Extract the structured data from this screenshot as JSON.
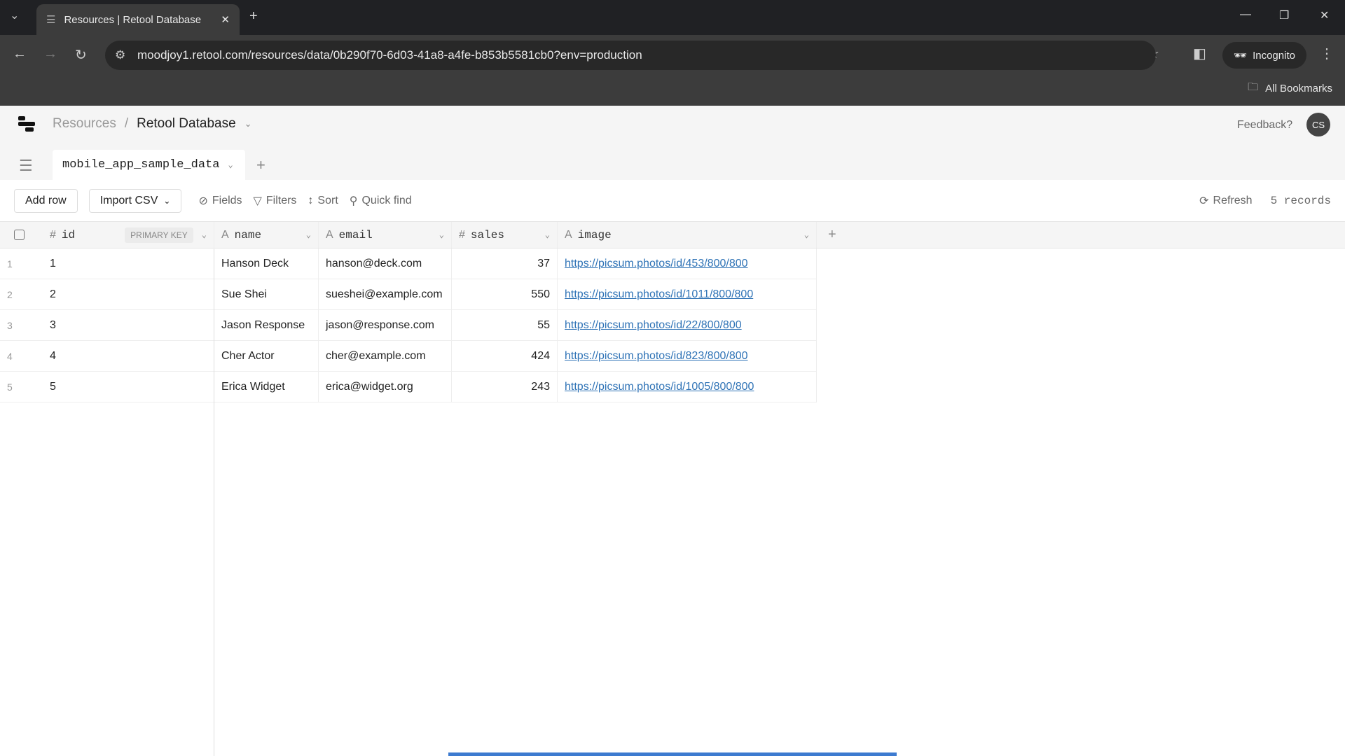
{
  "browser": {
    "tab_title": "Resources | Retool Database",
    "url": "moodjoy1.retool.com/resources/data/0b290f70-6d03-41a8-a4fe-b853b5581cb0?env=production",
    "incognito": "Incognito",
    "bookmarks": "All Bookmarks"
  },
  "header": {
    "crumb_parent": "Resources",
    "crumb_current": "Retool Database",
    "feedback": "Feedback?",
    "avatar": "CS"
  },
  "tabs": {
    "active": "mobile_app_sample_data"
  },
  "toolbar": {
    "add_row": "Add row",
    "import_csv": "Import CSV",
    "fields": "Fields",
    "filters": "Filters",
    "sort": "Sort",
    "quick_find": "Quick find",
    "refresh": "Refresh",
    "records": "5 records"
  },
  "table": {
    "columns": [
      {
        "type": "#",
        "name": "id",
        "badge": "PRIMARY KEY"
      },
      {
        "type": "A",
        "name": "name"
      },
      {
        "type": "A",
        "name": "email"
      },
      {
        "type": "#",
        "name": "sales"
      },
      {
        "type": "A",
        "name": "image"
      }
    ],
    "rows": [
      {
        "n": "1",
        "id": "1",
        "name": "Hanson Deck",
        "email": "hanson@deck.com",
        "sales": "37",
        "image": "https://picsum.photos/id/453/800/800"
      },
      {
        "n": "2",
        "id": "2",
        "name": "Sue Shei",
        "email": "sueshei@example.com",
        "sales": "550",
        "image": "https://picsum.photos/id/1011/800/800"
      },
      {
        "n": "3",
        "id": "3",
        "name": "Jason Response",
        "email": "jason@response.com",
        "sales": "55",
        "image": "https://picsum.photos/id/22/800/800"
      },
      {
        "n": "4",
        "id": "4",
        "name": "Cher Actor",
        "email": "cher@example.com",
        "sales": "424",
        "image": "https://picsum.photos/id/823/800/800"
      },
      {
        "n": "5",
        "id": "5",
        "name": "Erica Widget",
        "email": "erica@widget.org",
        "sales": "243",
        "image": "https://picsum.photos/id/1005/800/800"
      }
    ]
  },
  "colors": {
    "link": "#2f73b6",
    "progress": "#3d7bd0"
  }
}
